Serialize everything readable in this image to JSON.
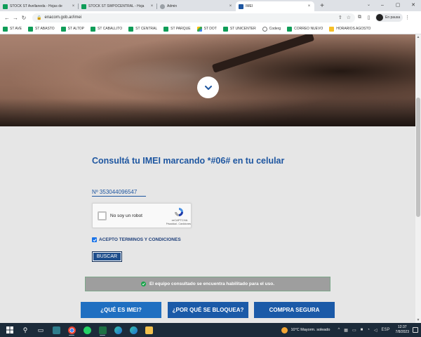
{
  "browser": {
    "tabs": [
      {
        "title": "STOCK ST Avellaneda - Hojas de",
        "favicon_color": "#0f9d58",
        "active": false
      },
      {
        "title": "STOCK ST SWPOCENTRAL - Hoja",
        "favicon_color": "#0f9d58",
        "active": false
      },
      {
        "title": "Admin",
        "favicon_color": "#9aa0a6",
        "active": false
      },
      {
        "title": "IMEI",
        "favicon_color": "#1e56a0",
        "active": true
      }
    ],
    "url": "enacom.gob.ar/imei",
    "profile_label": "En pausa",
    "bookmarks": [
      {
        "label": "ST AVE",
        "icon": "green"
      },
      {
        "label": "ST ABASTO",
        "icon": "green"
      },
      {
        "label": "ST ALTOP",
        "icon": "green"
      },
      {
        "label": "ST CABALLITO",
        "icon": "green"
      },
      {
        "label": "ST CENTRAL",
        "icon": "green"
      },
      {
        "label": "ST PARQUE",
        "icon": "green"
      },
      {
        "label": "ST DOT",
        "icon": "drive"
      },
      {
        "label": "ST UNICENTER",
        "icon": "green"
      },
      {
        "label": "Coderg",
        "icon": "globe"
      },
      {
        "label": "CORREO NUEVO",
        "icon": "green"
      },
      {
        "label": "HORARIOS AGOSTO",
        "icon": "yellow"
      }
    ]
  },
  "page": {
    "heading": "Consultá tu IMEI marcando *#06# en tu celular",
    "imei_value": "Nº 353044096547",
    "captcha": {
      "label": "No soy un robot",
      "brand": "reCAPTCHA",
      "terms": "Privacidad - Condiciones"
    },
    "accept_label": "ACEPTO TERMINOS Y CONDICIONES",
    "accept_checked": true,
    "search_button": "BUSCAR",
    "result_message": "El equipo consultado se encuentra habilitado para el uso.",
    "cta": {
      "what": "¿QUÉ ES IMEI?",
      "why": "¿POR QUÉ SE BLOQUEA?",
      "buy": "COMPRA SEGURA"
    }
  },
  "taskbar": {
    "weather": "10°C  Mayorm. soleado",
    "lang": "ESP",
    "time": "12:37",
    "date": "7/8/2023"
  },
  "colors": {
    "brand_blue": "#1e56a0",
    "success_green": "#19a34a"
  }
}
